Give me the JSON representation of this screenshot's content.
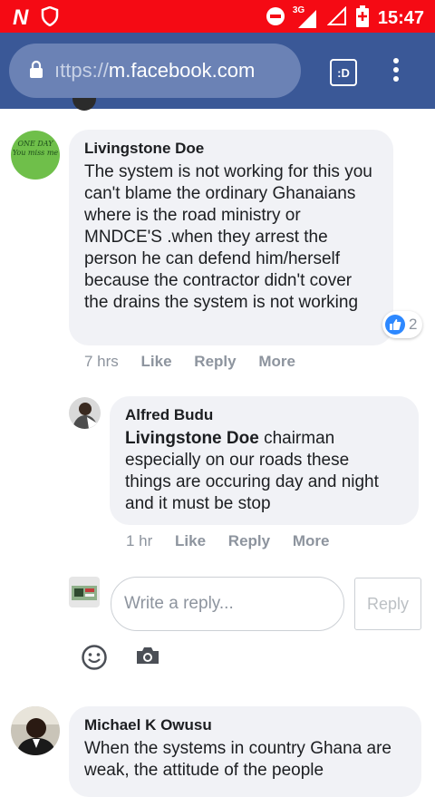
{
  "status_bar": {
    "network": "3G",
    "time": "15:47"
  },
  "browser": {
    "url_scheme": "ıttps://",
    "url_host": "m.facebook.com",
    "tab_button_label": ":D"
  },
  "comments": [
    {
      "author": "Livingstone Doe",
      "text": "The system is not working for this you can't blame the ordinary Ghanaians where is the road ministry or MNDCE'S .when they arrest the person he can defend him/herself because the contractor didn't cover the drains the system is not working",
      "time": "7 hrs",
      "like": "Like",
      "reply": "Reply",
      "more": "More",
      "reaction_count": "2",
      "avatar_text": [
        "ONE DAY",
        "You miss me"
      ]
    },
    {
      "author": "Alfred Budu",
      "mention": "Livingstone Doe",
      "text": " chairman especially on our roads these things are occuring day and night and it must be stop",
      "time": "1 hr",
      "like": "Like",
      "reply": "Reply",
      "more": "More"
    },
    {
      "author": "Michael K Owusu",
      "text": "When the systems in country Ghana are weak, the attitude of the people"
    }
  ],
  "reply_composer": {
    "placeholder": "Write a reply...",
    "button_label": "Reply"
  },
  "colors": {
    "status_bar": "#f50a14",
    "browser_bar": "#3a5897",
    "bubble": "#f1f2f6",
    "like_blue": "#2d88ff"
  }
}
